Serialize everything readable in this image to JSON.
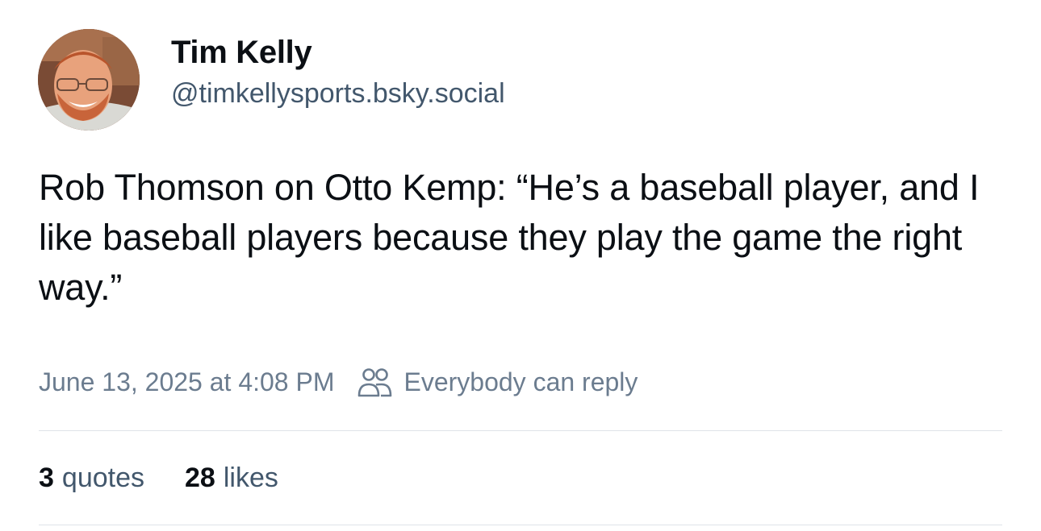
{
  "author": {
    "name": "Tim Kelly",
    "handle": "@timkellysports.bsky.social"
  },
  "post": {
    "text": "Rob Thomson on Otto Kemp: “He’s a baseball player, and I like baseball players because they play the game the right way.”",
    "timestamp": "June 13, 2025 at 4:08 PM",
    "reply_setting": "Everybody can reply",
    "reply_icon": "people-icon"
  },
  "stats": {
    "quotes_count": "3",
    "quotes_label": "quotes",
    "likes_count": "28",
    "likes_label": "likes"
  },
  "colors": {
    "text": "#0b0f14",
    "handle": "#42576c",
    "meta": "#6b7c8f",
    "divider": "#dfe3e8"
  }
}
